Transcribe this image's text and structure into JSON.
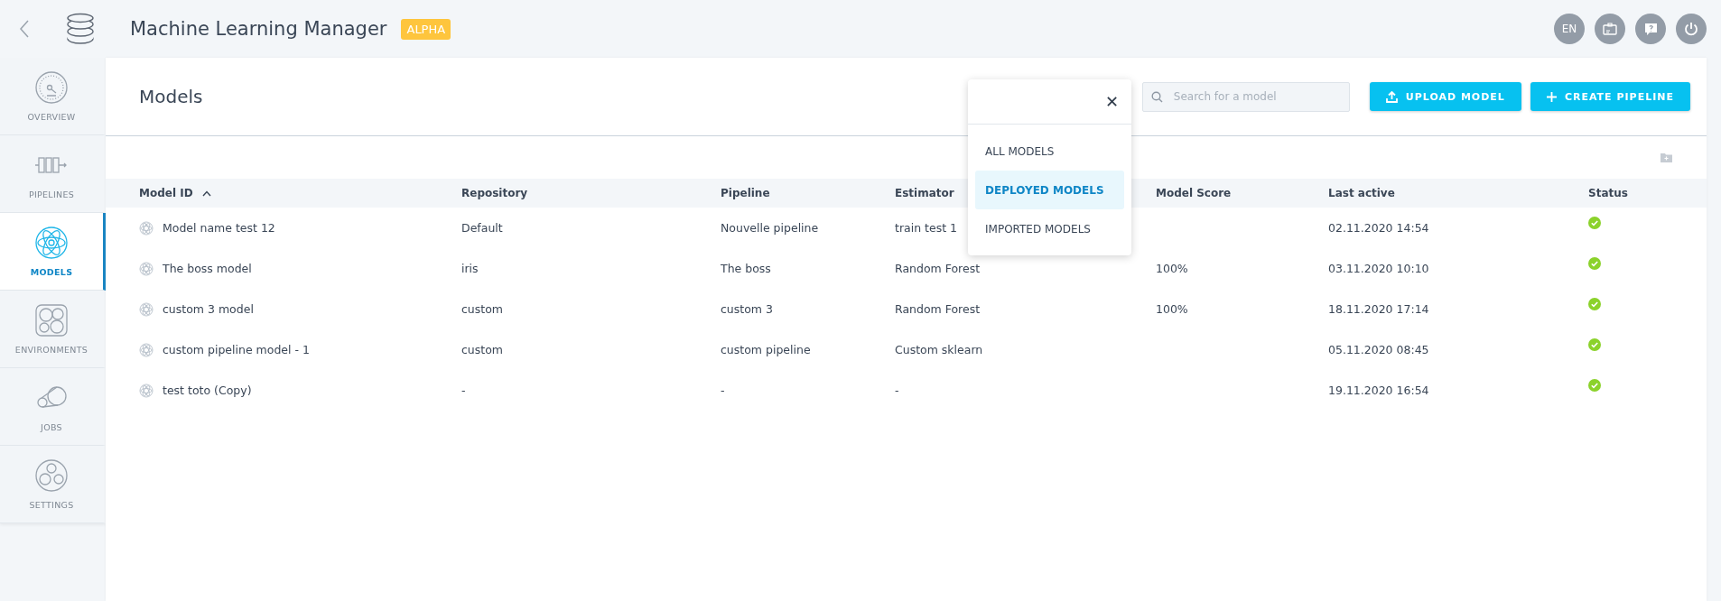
{
  "header": {
    "title": "Machine Learning Manager",
    "badge": "ALPHA",
    "language": "EN"
  },
  "sidebar": {
    "items": [
      {
        "label": "OVERVIEW",
        "kind": "gauge",
        "selected": false
      },
      {
        "label": "PIPELINES",
        "kind": "pipeline",
        "selected": false
      },
      {
        "label": "MODELS",
        "kind": "atom",
        "selected": true
      },
      {
        "label": "ENVIRONMENTS",
        "kind": "cells",
        "selected": false
      },
      {
        "label": "JOBS",
        "kind": "belt",
        "selected": false
      },
      {
        "label": "SETTINGS",
        "kind": "gears",
        "selected": false
      }
    ]
  },
  "page": {
    "title": "Models",
    "search": {
      "placeholder": "Search for a model"
    },
    "buttons": [
      {
        "label": "UPLOAD MODEL",
        "kind": "upload"
      },
      {
        "label": "CREATE PIPELINE",
        "kind": "plus"
      }
    ]
  },
  "filter_menu": {
    "close": "✕",
    "options": [
      {
        "label": "ALL MODELS",
        "selected": false
      },
      {
        "label": "DEPLOYED MODELS",
        "selected": true
      },
      {
        "label": "IMPORTED MODELS",
        "selected": false
      }
    ]
  },
  "table": {
    "columns": [
      {
        "label": "Model ID",
        "sorted": true
      },
      {
        "label": "Repository",
        "sorted": false
      },
      {
        "label": "Pipeline",
        "sorted": false
      },
      {
        "label": "Estimator",
        "sorted": false
      },
      {
        "label": "Model Score",
        "sorted": false
      },
      {
        "label": "Last active",
        "sorted": false
      },
      {
        "label": "Status",
        "sorted": false
      }
    ],
    "rows": [
      {
        "cells": [
          "Model name test 12",
          "Default",
          "Nouvelle pipeline",
          "train test 1",
          "",
          "02.11.2020 14:54"
        ],
        "ok": true
      },
      {
        "cells": [
          "The boss model",
          "iris",
          "The boss",
          "Random Forest",
          "100%",
          "03.11.2020 10:10"
        ],
        "ok": true
      },
      {
        "cells": [
          "custom 3 model",
          "custom",
          "custom 3",
          "Random Forest",
          "100%",
          "18.11.2020 17:14"
        ],
        "ok": true
      },
      {
        "cells": [
          "custom pipeline model - 1",
          "custom",
          "custom pipeline",
          "Custom sklearn",
          "",
          "05.11.2020 08:45"
        ],
        "ok": true
      },
      {
        "cells": [
          "test toto (Copy)",
          "-",
          "-",
          "-",
          "",
          "19.11.2020 16:54"
        ],
        "ok": true
      }
    ]
  }
}
